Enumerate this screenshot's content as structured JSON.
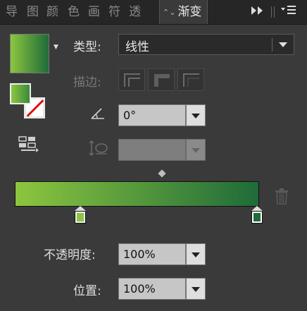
{
  "tabs": [
    {
      "label": "导"
    },
    {
      "label": "图"
    },
    {
      "label": "颜"
    },
    {
      "label": "色"
    },
    {
      "label": "画"
    },
    {
      "label": "符"
    },
    {
      "label": "透"
    }
  ],
  "active_tab": {
    "label": "渐变",
    "arrows": "⌃⌄"
  },
  "toolbar_icons": {
    "expand": "double-arrow-right-icon",
    "menu": "panel-menu-icon"
  },
  "type": {
    "label": "类型:",
    "value": "线性"
  },
  "stroke": {
    "label": "描边:"
  },
  "angle": {
    "value": "0°"
  },
  "aspect": {
    "value": ""
  },
  "gradient": {
    "start_color": "#8cc63f",
    "end_color": "#1f6b3a",
    "stops": [
      {
        "color": "#8cc63f",
        "location": 0
      },
      {
        "color": "#1f6b3a",
        "location": 100
      }
    ]
  },
  "opacity": {
    "label": "不透明度:",
    "value": "100%"
  },
  "location": {
    "label": "位置:",
    "value": "100%"
  }
}
